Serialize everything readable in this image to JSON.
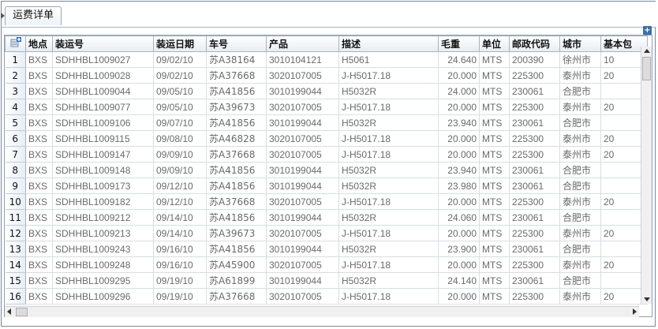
{
  "tab": {
    "label": "运费详单"
  },
  "grid": {
    "columns": [
      "地点",
      "装运号",
      "装运日期",
      "车号",
      "产品",
      "描述",
      "毛重",
      "单位",
      "邮政代码",
      "城市",
      "基本包"
    ],
    "rows": [
      [
        "1",
        "BXS",
        "SDHHBL1009027",
        "09/02/10",
        "苏A38164",
        "3010104121",
        "H5061",
        "24.640",
        "MTS",
        "200390",
        "徐州市",
        "10"
      ],
      [
        "2",
        "BXS",
        "SDHHBL1009028",
        "09/02/10",
        "苏A37668",
        "3020107005",
        "J-H5017.18",
        "20.000",
        "MTS",
        "225300",
        "泰州市",
        "20"
      ],
      [
        "3",
        "BXS",
        "SDHHBL1009044",
        "09/05/10",
        "苏A41856",
        "3010199044",
        "H5032R",
        "24.000",
        "MTS",
        "230061",
        "合肥市",
        ""
      ],
      [
        "4",
        "BXS",
        "SDHHBL1009077",
        "09/05/10",
        "苏A39673",
        "3020107005",
        "J-H5017.18",
        "20.000",
        "MTS",
        "225300",
        "泰州市",
        "20"
      ],
      [
        "5",
        "BXS",
        "SDHHBL1009106",
        "09/07/10",
        "苏A41856",
        "3010199044",
        "H5032R",
        "23.940",
        "MTS",
        "230061",
        "合肥市",
        ""
      ],
      [
        "6",
        "BXS",
        "SDHHBL1009115",
        "09/08/10",
        "苏A46828",
        "3020107005",
        "J-H5017.18",
        "20.000",
        "MTS",
        "225300",
        "泰州市",
        "20"
      ],
      [
        "7",
        "BXS",
        "SDHHBL1009147",
        "09/09/10",
        "苏A37668",
        "3020107005",
        "J-H5017.18",
        "20.000",
        "MTS",
        "225300",
        "泰州市",
        "20"
      ],
      [
        "8",
        "BXS",
        "SDHHBL1009148",
        "09/09/10",
        "苏A41856",
        "3010199044",
        "H5032R",
        "23.940",
        "MTS",
        "230061",
        "合肥市",
        ""
      ],
      [
        "9",
        "BXS",
        "SDHHBL1009173",
        "09/12/10",
        "苏A41856",
        "3010199044",
        "H5032R",
        "23.980",
        "MTS",
        "230061",
        "合肥市",
        ""
      ],
      [
        "10",
        "BXS",
        "SDHHBL1009182",
        "09/12/10",
        "苏A37668",
        "3020107005",
        "J-H5017.18",
        "20.000",
        "MTS",
        "225300",
        "泰州市",
        "20"
      ],
      [
        "11",
        "BXS",
        "SDHHBL1009212",
        "09/14/10",
        "苏A41856",
        "3010199044",
        "H5032R",
        "24.060",
        "MTS",
        "230061",
        "合肥市",
        ""
      ],
      [
        "12",
        "BXS",
        "SDHHBL1009213",
        "09/14/10",
        "苏A39673",
        "3020107005",
        "J-H5017.18",
        "20.000",
        "MTS",
        "225300",
        "泰州市",
        "20"
      ],
      [
        "13",
        "BXS",
        "SDHHBL1009243",
        "09/16/10",
        "苏A41856",
        "3010199044",
        "H5032R",
        "23.900",
        "MTS",
        "230061",
        "合肥市",
        ""
      ],
      [
        "14",
        "BXS",
        "SDHHBL1009248",
        "09/16/10",
        "苏A45900",
        "3020107005",
        "J-H5017.18",
        "20.000",
        "MTS",
        "225300",
        "泰州市",
        "20"
      ],
      [
        "15",
        "BXS",
        "SDHHBL1009295",
        "09/19/10",
        "苏A61899",
        "3010199044",
        "H5032R",
        "24.140",
        "MTS",
        "230061",
        "合肥市",
        ""
      ],
      [
        "16",
        "BXS",
        "SDHHBL1009296",
        "09/19/10",
        "苏A37668",
        "3020107005",
        "J-H5017.18",
        "20.000",
        "MTS",
        "225300",
        "泰州市",
        "20"
      ]
    ]
  },
  "icons": {
    "corner": "add-row-icon",
    "top_right": "add-column-icon",
    "scroll_up": "scroll-up-arrow-icon",
    "scroll_down": "scroll-down-arrow-icon",
    "scroll_left": "scroll-left-arrow-icon",
    "scroll_right": "scroll-right-arrow-icon"
  },
  "colors": {
    "cell_text": "#6a6a6a",
    "header_text": "#111111",
    "accent_blue": "#3a6ea5"
  }
}
